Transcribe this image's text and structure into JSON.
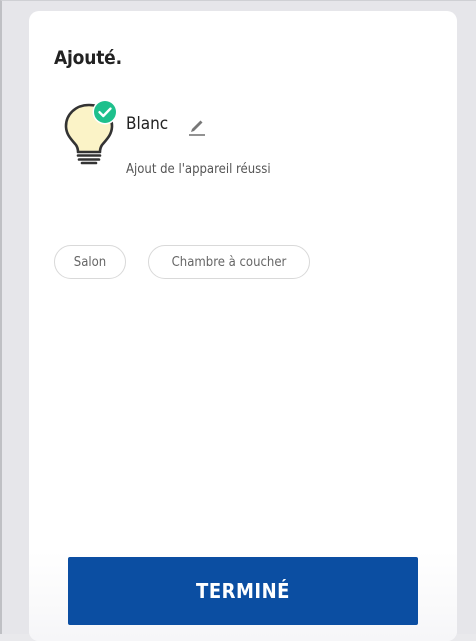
{
  "dialog": {
    "title": "Ajouté.",
    "device": {
      "name": "Blanc",
      "status": "Ajout de l'appareil réussi",
      "icon": "light-bulb-icon",
      "badge_icon": "check-circle-icon",
      "edit_icon": "pencil-icon"
    },
    "rooms": [
      {
        "label": "Salon"
      },
      {
        "label": "Chambre à coucher"
      }
    ],
    "done_button": {
      "label": "TERMINÉ"
    }
  },
  "colors": {
    "primary": "#0b4ea2",
    "success": "#1ec08c",
    "bulb_glass": "#fbf3c7",
    "background": "#e6e6ea"
  }
}
